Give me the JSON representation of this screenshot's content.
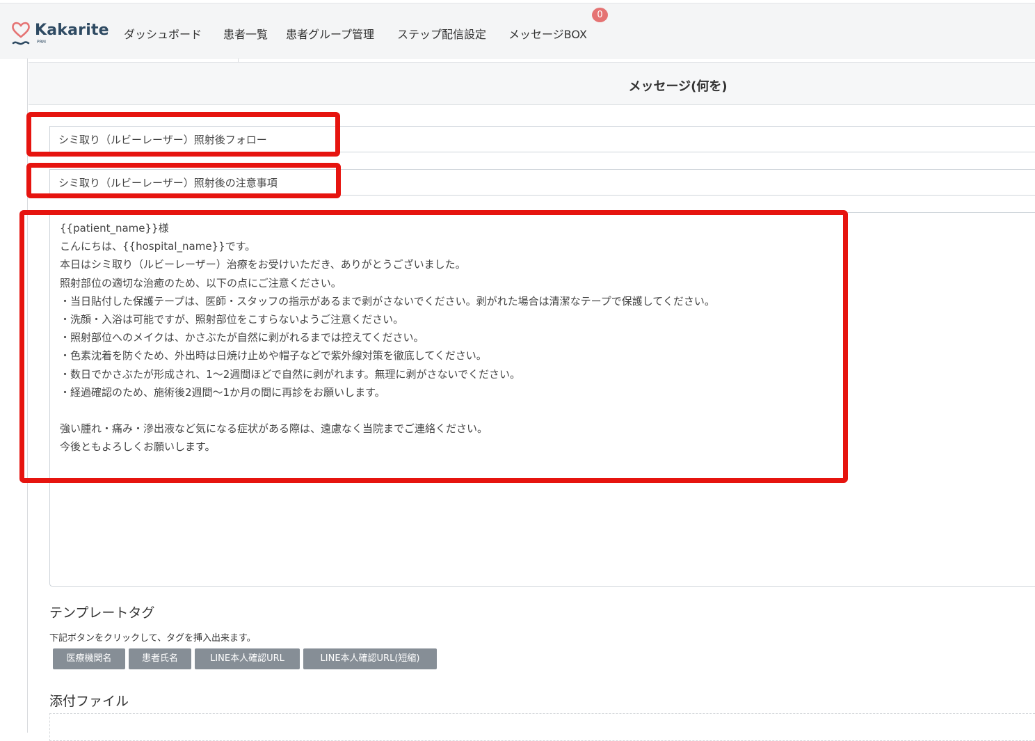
{
  "app": {
    "logo_text": "Kakarite",
    "logo_sub": "PRM",
    "brand_color": "#2e4a62",
    "accent_color": "#e57373"
  },
  "nav": {
    "items": [
      {
        "label": "ダッシュボード"
      },
      {
        "label": "患者一覧"
      },
      {
        "label": "患者グループ管理"
      },
      {
        "label": "ステップ配信設定"
      },
      {
        "label": "メッセージBOX"
      }
    ],
    "message_badge": "0"
  },
  "card": {
    "title": "メッセージ(何を)"
  },
  "form": {
    "title_value": "シミ取り（ルビーレーザー）照射後フォロー",
    "subject_value": "シミ取り（ルビーレーザー）照射後の注意事項",
    "body_value": "{{patient_name}}様\nこんにちは、{{hospital_name}}です。\n本日はシミ取り（ルビーレーザー）治療をお受けいただき、ありがとうございました。\n照射部位の適切な治癒のため、以下の点にご注意ください。\n・当日貼付した保護テープは、医師・スタッフの指示があるまで剥がさないでください。剥がれた場合は清潔なテープで保護してください。\n・洗顔・入浴は可能ですが、照射部位をこすらないようご注意ください。\n・照射部位へのメイクは、かさぶたが自然に剥がれるまでは控えてください。\n・色素沈着を防ぐため、外出時は日焼け止めや帽子などで紫外線対策を徹底してください。\n・数日でかさぶたが形成され、1〜2週間ほどで自然に剥がれます。無理に剥がさないでください。\n・経過確認のため、施術後2週間〜1か月の間に再診をお願いします。\n\n強い腫れ・痛み・滲出液など気になる症状がある際は、遠慮なく当院までご連絡ください。\n今後ともよろしくお願いします。"
  },
  "template_tags": {
    "heading": "テンプレートタグ",
    "hint": "下記ボタンをクリックして、タグを挿入出来ます。",
    "buttons": [
      {
        "label": "医療機関名"
      },
      {
        "label": "患者氏名"
      },
      {
        "label": "LINE本人確認URL"
      },
      {
        "label": "LINE本人確認URL(短縮)"
      }
    ]
  },
  "attachment": {
    "heading": "添付ファイル"
  },
  "highlight_color": "#e6140f"
}
